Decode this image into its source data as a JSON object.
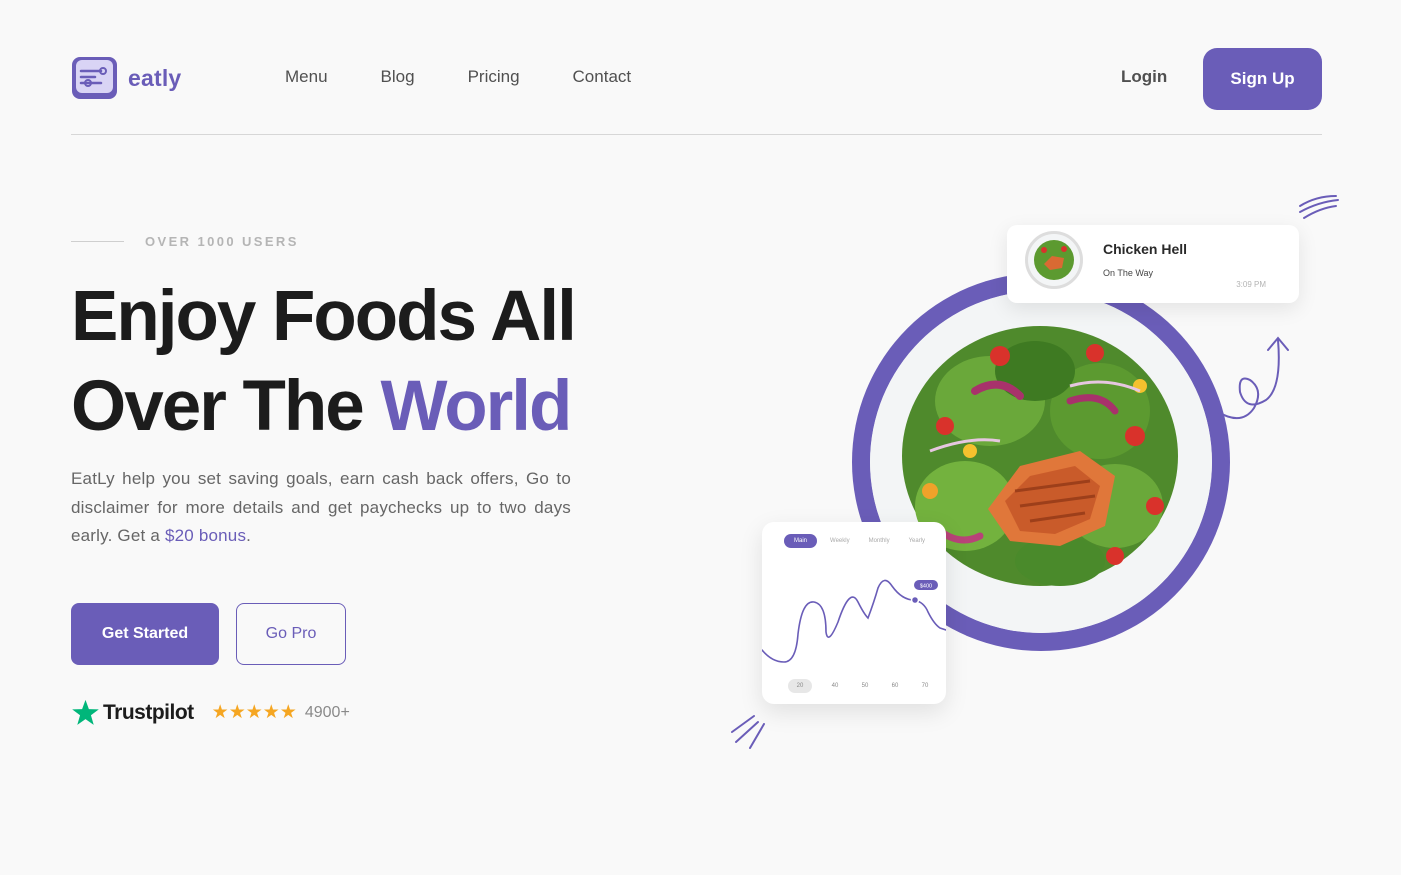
{
  "header": {
    "logo_text": "eatly",
    "nav": [
      "Menu",
      "Blog",
      "Pricing",
      "Contact"
    ],
    "login_label": "Login",
    "signup_label": "Sign Up"
  },
  "hero": {
    "eyebrow": "OVER 1000 USERS",
    "headline_line1": "Enjoy Foods All",
    "headline_line2_a": "Over The ",
    "headline_line2_b": "World",
    "description_a": "EatLy help you set saving goals, earn cash back offers, Go to disclaimer for more details and get paychecks up to two days early. Get a ",
    "description_bonus": "$20 bonus",
    "description_end": ".",
    "primary_cta": "Get Started",
    "secondary_cta": "Go Pro",
    "trust_brand": "Trustpilot",
    "stars": "★★★★★",
    "rating_count": "4900+"
  },
  "notification": {
    "title": "Chicken Hell",
    "subtitle": "On The Way",
    "time": "3:09 PM"
  },
  "stat_card": {
    "tabs": [
      "Main",
      "Weekly",
      "Monthly",
      "Yearly"
    ],
    "badge": "$400",
    "x_labels": [
      "20",
      "40",
      "50",
      "60",
      "70"
    ]
  },
  "colors": {
    "accent": "#6a5db8",
    "star": "#f5a622",
    "trustpilot_green": "#00b67a"
  }
}
